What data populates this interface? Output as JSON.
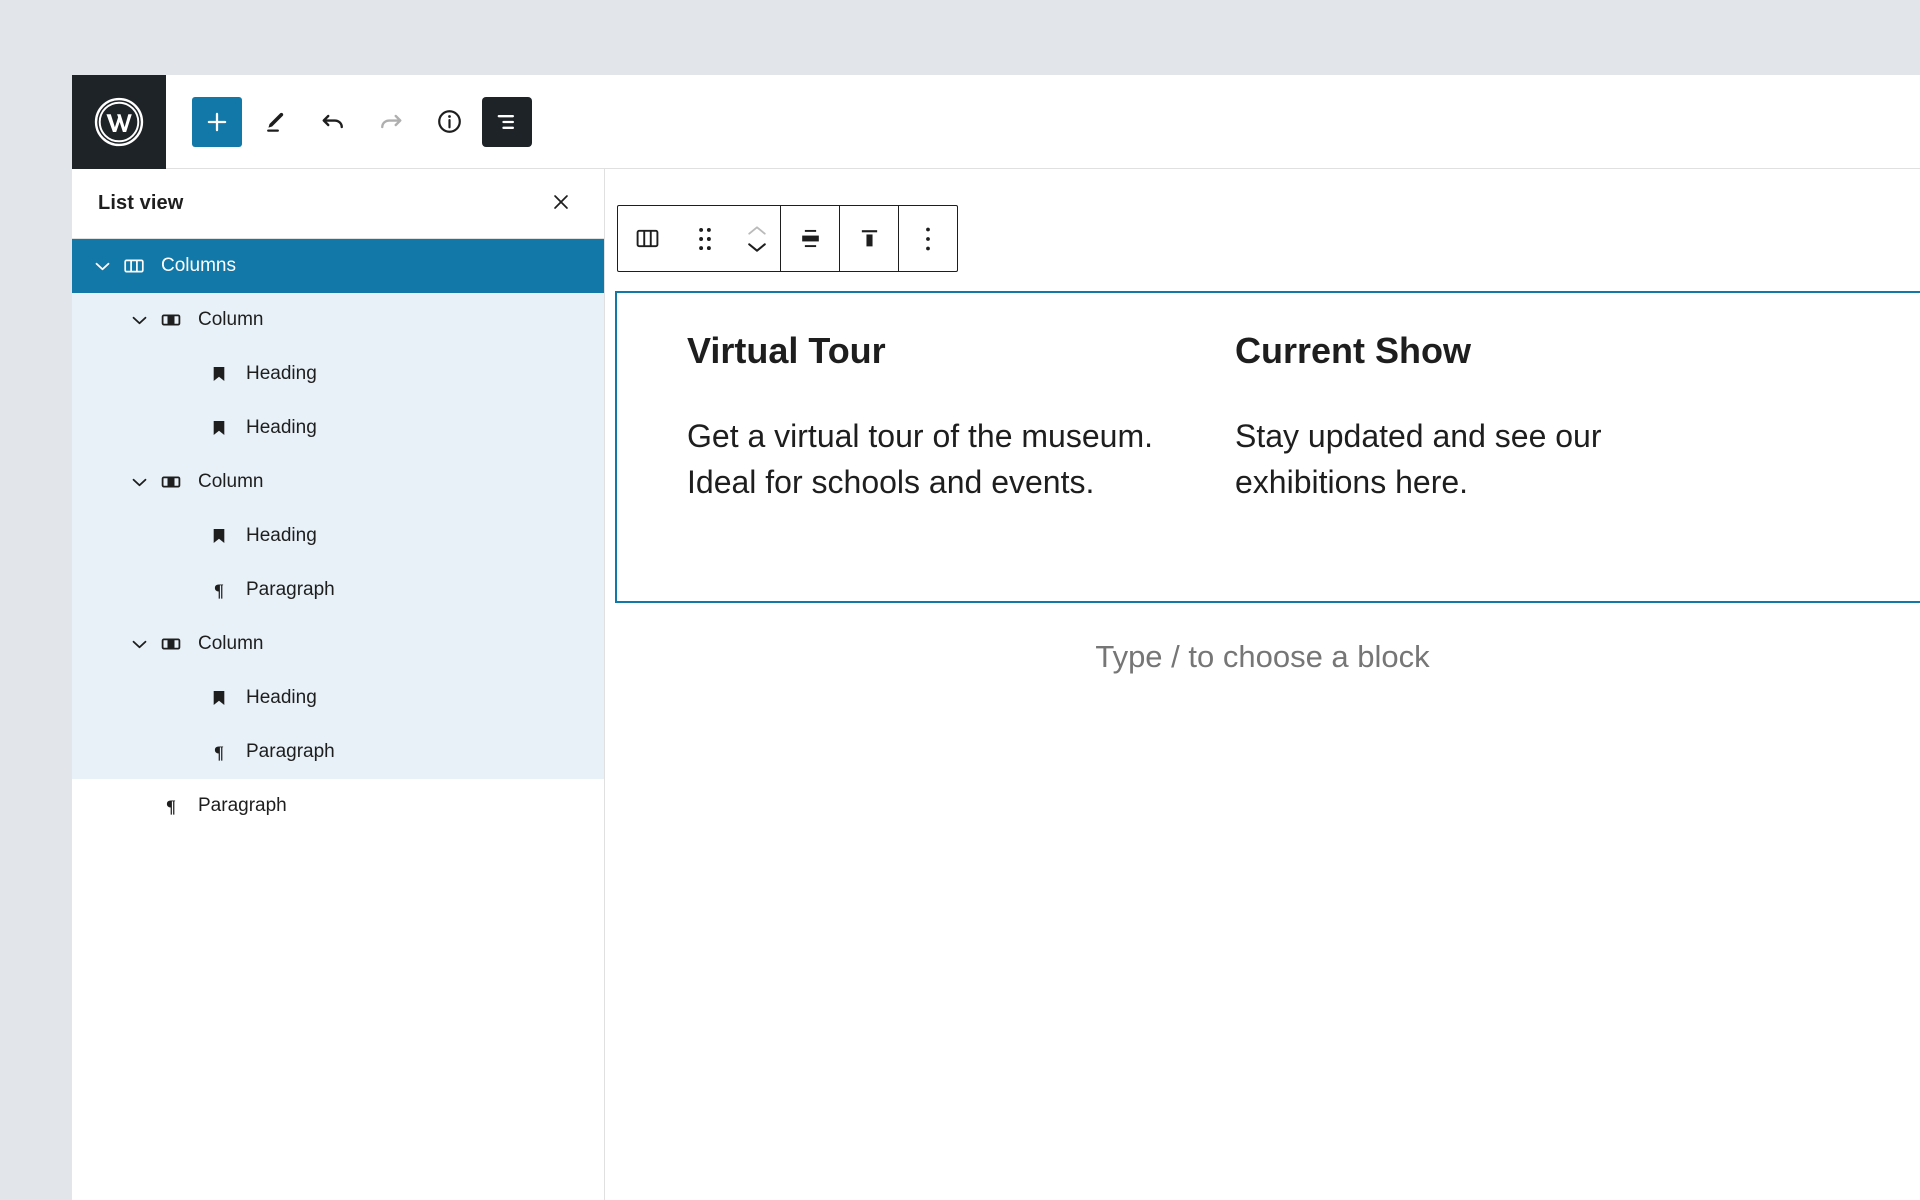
{
  "app": {
    "logo_icon": "wordpress-logo-icon"
  },
  "toolbar": {
    "add_label": "+",
    "items": [
      {
        "name": "add-block-button",
        "icon": "plus-icon",
        "state": "primary"
      },
      {
        "name": "edit-tool-button",
        "icon": "pencil-icon",
        "state": "default"
      },
      {
        "name": "undo-button",
        "icon": "undo-arrow-icon",
        "state": "default"
      },
      {
        "name": "redo-button",
        "icon": "redo-arrow-icon",
        "state": "disabled"
      },
      {
        "name": "details-button",
        "icon": "info-circle-icon",
        "state": "default"
      },
      {
        "name": "list-view-toggle",
        "icon": "list-view-icon",
        "state": "active"
      }
    ]
  },
  "list_view": {
    "title": "List view",
    "close_label": "×",
    "rows": [
      {
        "label": "Columns",
        "icon": "columns-icon",
        "indent": 0,
        "style": "selected",
        "expanded": true
      },
      {
        "label": "Column",
        "icon": "column-icon",
        "indent": 1,
        "style": "nested",
        "expanded": true
      },
      {
        "label": "Heading",
        "icon": "heading-icon",
        "indent": 2,
        "style": "nested",
        "expanded": null
      },
      {
        "label": "Heading",
        "icon": "heading-icon",
        "indent": 2,
        "style": "nested",
        "expanded": null
      },
      {
        "label": "Column",
        "icon": "column-icon",
        "indent": 1,
        "style": "nested",
        "expanded": true
      },
      {
        "label": "Heading",
        "icon": "heading-icon",
        "indent": 2,
        "style": "nested",
        "expanded": null
      },
      {
        "label": "Paragraph",
        "icon": "paragraph-icon",
        "indent": 2,
        "style": "nested",
        "expanded": null
      },
      {
        "label": "Column",
        "icon": "column-icon",
        "indent": 1,
        "style": "nested",
        "expanded": true
      },
      {
        "label": "Heading",
        "icon": "heading-icon",
        "indent": 2,
        "style": "nested",
        "expanded": null
      },
      {
        "label": "Paragraph",
        "icon": "paragraph-icon",
        "indent": 2,
        "style": "nested",
        "expanded": null
      },
      {
        "label": "Paragraph",
        "icon": "paragraph-icon",
        "indent": 1,
        "style": "plain",
        "expanded": null
      }
    ]
  },
  "block_toolbar": {
    "buttons": [
      {
        "name": "block-type-columns-button",
        "icon": "columns-icon"
      },
      {
        "name": "drag-handle",
        "icon": "six-dots-drag-icon"
      },
      {
        "name": "move-up-down-button",
        "icon": "chevron-up-down-icon"
      },
      {
        "name": "vertical-align-center-button",
        "icon": "align-middle-icon"
      },
      {
        "name": "vertical-align-top-button",
        "icon": "align-top-icon"
      },
      {
        "name": "more-options-button",
        "icon": "three-dots-vertical-icon"
      }
    ]
  },
  "editor": {
    "columns": [
      {
        "heading": "Virtual Tour",
        "paragraph": "Get a virtual tour of the museum. Ideal for schools and events."
      },
      {
        "heading": "Current Show",
        "paragraph": "Stay updated and see our exhibitions here."
      }
    ],
    "placeholder": "Type / to choose a block"
  },
  "colors": {
    "accent_blue": "#1278a8",
    "selected_row_bg": "#1278a8",
    "nested_row_bg": "#e8f1f8",
    "dark": "#1e2327",
    "text": "#1e1e1e",
    "muted": "#767676"
  }
}
